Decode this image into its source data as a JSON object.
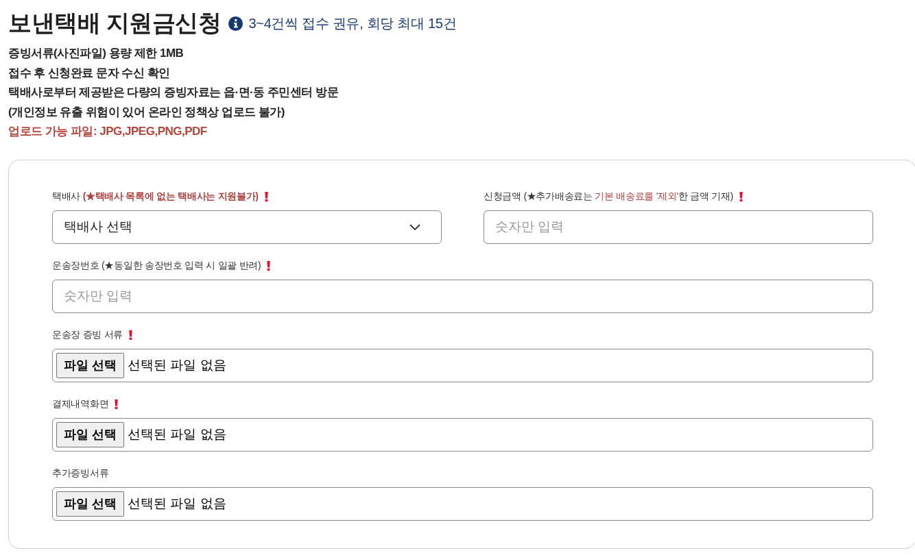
{
  "header": {
    "title": "보낸택배 지원금신청",
    "note": "3~4건씩 접수 권유, 회당 최대 15건"
  },
  "notices": [
    {
      "text": "증빙서류(사진파일) 용량 제한 1MB",
      "kind": "plain"
    },
    {
      "text": "접수 후 신청완료 문자 수신 확인",
      "kind": "plain"
    },
    {
      "text": "택배사로부터 제공받은 다량의 증빙자료는 읍·면·동 주민센터 방문",
      "kind": "plain"
    },
    {
      "text": "(개인정보 유출 위험이 있어 온라인 정책상 업로드 불가)",
      "kind": "plain"
    },
    {
      "text": "업로드 가능 파일: JPG,JPEG,PNG,PDF",
      "kind": "warning"
    }
  ],
  "form": {
    "rows": [
      {
        "fields": [
          {
            "kind": "select",
            "label": [
              {
                "text": "택배사 ",
                "kind": "plain"
              },
              {
                "text": "(★택배사 목록에 없는 택배사는 지원불가)",
                "kind": "emphasis"
              }
            ],
            "required": true,
            "value": "택배사 선택"
          },
          {
            "kind": "text",
            "label": [
              {
                "text": "신청금액 (★추가배송료는 ",
                "kind": "plain"
              },
              {
                "text": "기본 배송료를 '제외'",
                "kind": "accent"
              },
              {
                "text": "한 금액 기재)",
                "kind": "plain"
              }
            ],
            "required": true,
            "placeholder": "숫자만 입력"
          }
        ]
      },
      {
        "fields": [
          {
            "kind": "text",
            "label": [
              {
                "text": "운송장번호 (★동일한 송장번호 입력 시 일괄 반려)",
                "kind": "plain"
              }
            ],
            "required": true,
            "placeholder": "숫자만 입력"
          }
        ]
      },
      {
        "fields": [
          {
            "kind": "file",
            "label": [
              {
                "text": "운송장 증빙 서류",
                "kind": "plain"
              }
            ],
            "required": true,
            "button": "파일 선택",
            "status": "선택된 파일 없음"
          }
        ]
      },
      {
        "fields": [
          {
            "kind": "file",
            "label": [
              {
                "text": "결제내역화면",
                "kind": "plain"
              }
            ],
            "required": true,
            "button": "파일 선택",
            "status": "선택된 파일 없음"
          }
        ]
      },
      {
        "fields": [
          {
            "kind": "file",
            "label": [
              {
                "text": "추가증빙서류",
                "kind": "plain"
              }
            ],
            "required": false,
            "button": "파일 선택",
            "status": "선택된 파일 없음"
          }
        ]
      }
    ]
  }
}
